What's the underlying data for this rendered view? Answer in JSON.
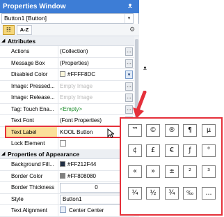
{
  "window": {
    "title": "Properties Window",
    "pin_glyph": "ᴥ"
  },
  "selector": {
    "value": "Button1 [Button]",
    "arrow_glyph": "▾"
  },
  "toolbar": {
    "categorized_label": "☷",
    "alphabetical_label": "A-Z",
    "settings_icon": "wrench-icon",
    "settings_glyph": "⚙"
  },
  "sections": [
    {
      "title": "Attributes"
    },
    {
      "title": "Properties of Appearance"
    }
  ],
  "attributes": [
    {
      "name": "Actions",
      "value": "(Collection)",
      "editor": "dots"
    },
    {
      "name": "Message Box",
      "value": "(Properties)",
      "editor": "dots"
    },
    {
      "name": "Disabled Color",
      "value": "#FFFF8DC",
      "swatch": "#FFF8DC",
      "editor": "dropdown"
    },
    {
      "name": "Image: Pressed...",
      "value": "Empty Image",
      "style": "dim",
      "editor": "dots"
    },
    {
      "name": "Image: Release...",
      "value": "Empty Image",
      "style": "dim",
      "editor": "dots"
    },
    {
      "name": "Tag: Touch Ena...",
      "value": "<Empty>",
      "style": "green",
      "editor": "dots"
    },
    {
      "name": "Text Font",
      "value": "(Font Properties)",
      "editor": "dots"
    },
    {
      "name": "Text Label",
      "value": "KOOL Button",
      "editor": "dropdown"
    },
    {
      "name": "Lock Element",
      "value": "",
      "editor": "checkbox"
    }
  ],
  "appearance": [
    {
      "name": "Background Fill...",
      "value": "#FF212F44",
      "swatch": "#212F44"
    },
    {
      "name": "Border Color",
      "value": "#FF808080",
      "swatch": "#808080"
    },
    {
      "name": "Border Thickness",
      "value": "0"
    },
    {
      "name": "Style",
      "value": "Button1"
    },
    {
      "name": "Text Alignment",
      "value": "Center Center"
    }
  ],
  "symbols": [
    "™",
    "©",
    "®",
    "¶",
    "µ",
    "¢",
    "£",
    "€",
    "ƒ",
    "°",
    "«",
    "»",
    "±",
    "²",
    "³",
    "¼",
    "½",
    "¾",
    "‰",
    "..."
  ],
  "glyphs": {
    "caret_open": "◢",
    "dots": "...",
    "dropdown": "▾"
  },
  "colors": {
    "title_bar": "#3D7DD6",
    "highlight": "#E5303A",
    "selected_name": "#FBE09A"
  }
}
